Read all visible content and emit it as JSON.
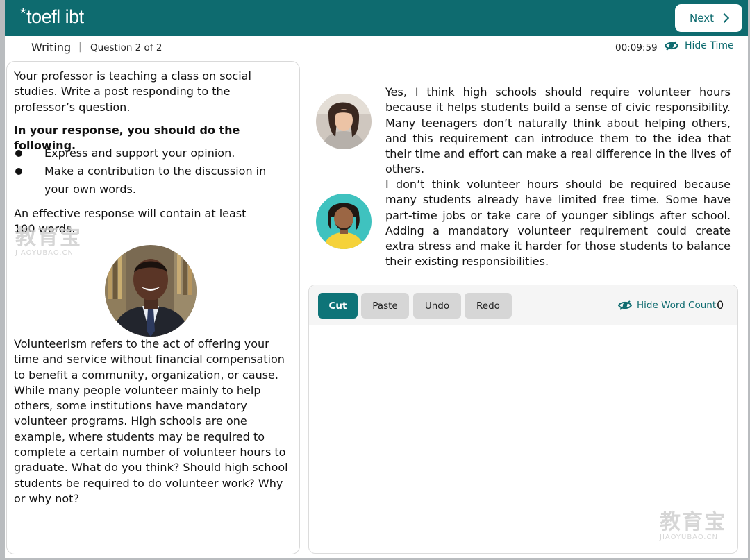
{
  "header": {
    "logo_text": "toefl ibt",
    "logo_star": "*",
    "next_label": "Next",
    "section_label": "Writing",
    "separator": "|",
    "question_label": "Question 2 of 2",
    "timer": "00:09:59",
    "hide_time_label": "Hide Time"
  },
  "prompt": {
    "intro": "Your professor is teaching a class on social studies. Write a post responding to the professor’s question.",
    "instruction_heading": "In your response, you should do the following.",
    "bullets": [
      "Express and support your opinion.",
      "Make a contribution to the discussion in your own words."
    ],
    "length_note": "An effective response will contain at least 100 words.",
    "professor_text": "Volunteerism refers to the act of offering your time and service without financial compensation to benefit a community, organization, or cause.  While many people volunteer mainly to help others, some institutions have mandatory volunteer programs.  High schools are one example, where students may be required to complete a certain number of volunteer hours to graduate.  What do you think? Should high school students be required to do volunteer work? Why or why not?"
  },
  "posts": [
    {
      "text": "Yes, I think high schools should require volunteer hours because it helps students build a sense of civic responsibility. Many teenagers don’t naturally think about helping others, and this requirement can introduce them to the idea that their time and effort can make a real difference in the lives of others."
    },
    {
      "text": "I don’t think volunteer hours should be required because many students already have limited free time.  Some have part-time jobs or take care of younger siblings after school.  Adding a mandatory volunteer requirement could create extra stress and make it harder for those students to balance their existing responsibilities."
    }
  ],
  "editor": {
    "cut_label": "Cut",
    "paste_label": "Paste",
    "undo_label": "Undo",
    "redo_label": "Redo",
    "hide_word_count_label": "Hide Word Count",
    "word_count": "0",
    "response_value": ""
  },
  "watermarks": {
    "chinese": "教育宝",
    "domain": "JIAOYUBAO.CN"
  },
  "colors": {
    "brand_teal": "#0e6b6f",
    "button_teal": "#0e7478",
    "button_gray": "#d6d6d6"
  }
}
